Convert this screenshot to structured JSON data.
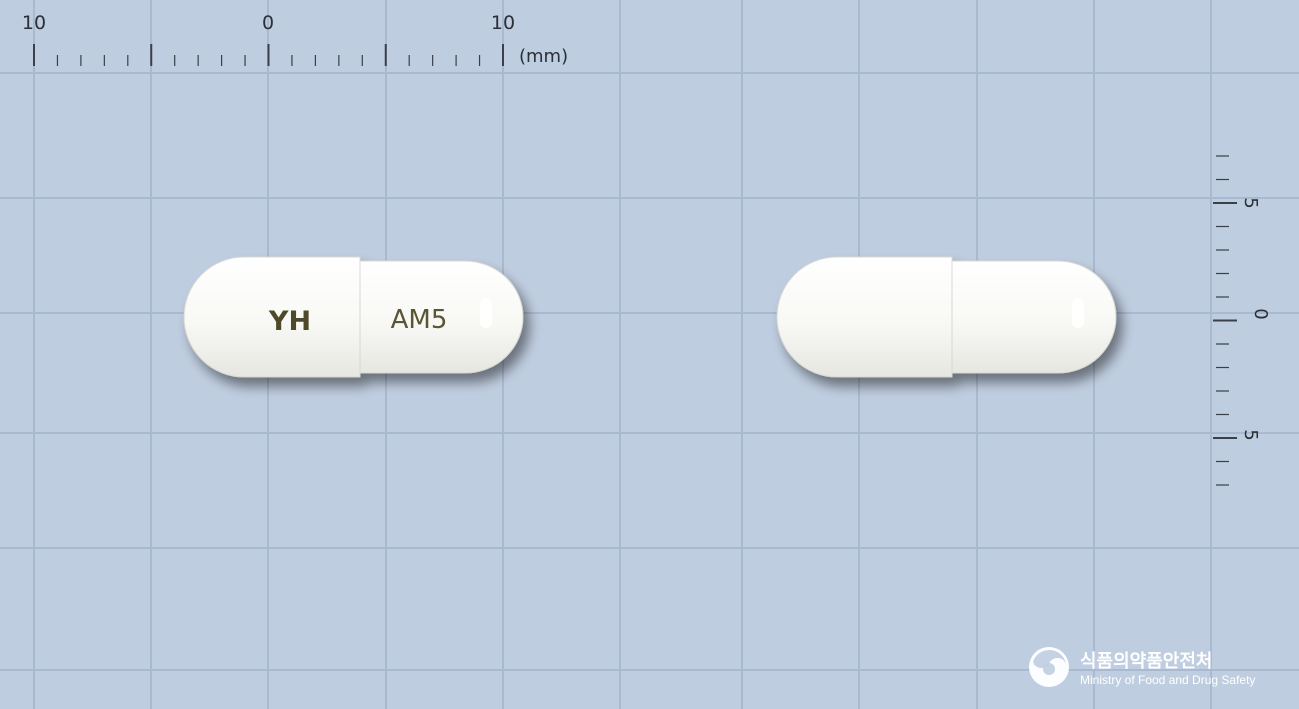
{
  "top_ruler": {
    "labels": [
      "10",
      "0",
      "10"
    ],
    "unit": "(mm)"
  },
  "side_ruler": {
    "labels": [
      "5",
      "0",
      "5"
    ]
  },
  "capsule_front": {
    "left_imprint": "YH",
    "right_imprint": "AM5"
  },
  "watermark": {
    "name_ko": "식품의약품안전처",
    "name_en": "Ministry of Food and Drug Safety"
  },
  "colors": {
    "background": "#bfcde0",
    "grid": "#a9b9cf",
    "capsule": "#f7f7f4",
    "imprint": "#4f4a2c"
  }
}
